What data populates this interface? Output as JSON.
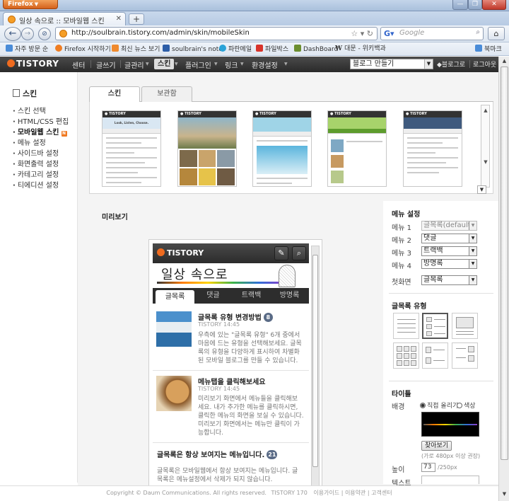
{
  "browser": {
    "app_button": "Firefox",
    "tab_title": "일상 속으로 :: 모바일웹 스킨",
    "new_tab": "+",
    "url": "http://soulbrain.tistory.com/admin/skin/mobileSkin",
    "search_placeholder": "Google",
    "bookmarks": [
      {
        "label": "자주 방문 순",
        "color": "#4a8cd8"
      },
      {
        "label": "Firefox 시작하기",
        "color": "#ef7d22"
      },
      {
        "label": "최신 뉴스 보기",
        "color": "#ef8a2e"
      },
      {
        "label": "soulbrain's note",
        "color": "#2c5ea8"
      },
      {
        "label": "파란메일",
        "color": "#2aa3d8"
      },
      {
        "label": "파일박스",
        "color": "#d8342a"
      },
      {
        "label": "DashBoard",
        "color": "#6b8e2f"
      },
      {
        "label": "W",
        "color": "#555555"
      },
      {
        "label": "대문 - 위키백과",
        "color": "#ffffff"
      },
      {
        "label": "북마크",
        "color": "#4a8cd8"
      }
    ]
  },
  "header": {
    "logo": "TISTORY",
    "menu": [
      "센터",
      "글쓰기",
      "글관리",
      "스킨",
      "플러그인",
      "링크",
      "환경설정"
    ],
    "active_menu": "스킨",
    "blog_select": "블로그 만들기",
    "links": [
      "블로그로",
      "로그아웃"
    ]
  },
  "sidebar": {
    "title": "스킨",
    "items": [
      {
        "label": "스킨 선택"
      },
      {
        "label": "HTML/CSS 편집"
      },
      {
        "label": "모바일웹 스킨",
        "active": true
      },
      {
        "label": "메뉴 설정"
      },
      {
        "label": "사이드바 설정"
      },
      {
        "label": "화면출력 설정"
      },
      {
        "label": "카테고리 설정"
      },
      {
        "label": "티에디션 설정"
      }
    ],
    "new_badge": "N"
  },
  "skin_tabs": [
    "스킨",
    "보관함"
  ],
  "thumbnails": [
    {
      "name": "Look, Listen, Choose.",
      "banner": "#d9e7f3"
    },
    {
      "name": "photo",
      "banner": "#6d8b9e"
    },
    {
      "name": "blue",
      "banner": "#9fd4e7"
    },
    {
      "name": "green",
      "banner": "#a7d36b"
    },
    {
      "name": "navy",
      "banner": "#3f5a7e"
    }
  ],
  "preview": {
    "label": "미리보기",
    "logo": "TISTORY",
    "blog_title": "일상 속으로",
    "tabs": [
      "글목록",
      "댓글",
      "트랙백",
      "방명록"
    ],
    "posts": [
      {
        "title": "글목록 유형 변경방법",
        "count": "8",
        "meta": "TISTORY 14:45",
        "body": [
          "우측에 있는 \"글목록 유형\" 6개 중에서",
          "마음에 드는 유형을 선택해보세요. 글목",
          "록의 유형을 다양하게 표시하여 차별화",
          "된 모바일 블로그를 만들 수 있습니다."
        ]
      },
      {
        "title": "메뉴탭을 클릭해보세요",
        "count": "",
        "meta": "TISTORY 14:45",
        "body": [
          "미리보기 화면에서 메뉴들을 클릭해보",
          "세요. 내가 추가한 메뉴를 클릭하시면,",
          "클릭한 메뉴의 화면을 보실 수 있습니다.",
          "미리보기 화면에서는 메뉴만 클릭이 가",
          "능합니다."
        ]
      },
      {
        "title": "글목록은 항상 보여지는 메뉴입니다.",
        "count": "21",
        "meta": "",
        "body": [
          "글목록은 모바일웹에서 항상 보여지는 메뉴입니다. 글",
          "목록은 메뉴설정에서 삭제가 되지 않습니다."
        ]
      }
    ]
  },
  "settings": {
    "menu_heading": "메뉴 설정",
    "menus": [
      {
        "label": "메뉴 1",
        "value": "글목록(default)",
        "disabled": true
      },
      {
        "label": "메뉴 2",
        "value": "댓글"
      },
      {
        "label": "메뉴 3",
        "value": "트랙백"
      },
      {
        "label": "메뉴 4",
        "value": "방명록"
      }
    ],
    "first_screen_label": "첫화면",
    "first_screen_value": "글목록",
    "list_type_heading": "글목록 유형",
    "title_heading": "타이틀",
    "background_label": "배경",
    "radio_direct": "직접 올리기",
    "radio_color": "색상",
    "upload_button": "찾아보기",
    "upload_hint": "(가로 480px 이상 권장)",
    "height_label": "높이",
    "height_value": "73",
    "height_unit": "/250px",
    "text_label": "텍스트"
  },
  "footer": {
    "copyright": "Copyright © Daum Communications. All rights reserved.",
    "version": "TISTORY 170",
    "links": [
      "이용가이드",
      "이용약관",
      "고객센터"
    ]
  }
}
